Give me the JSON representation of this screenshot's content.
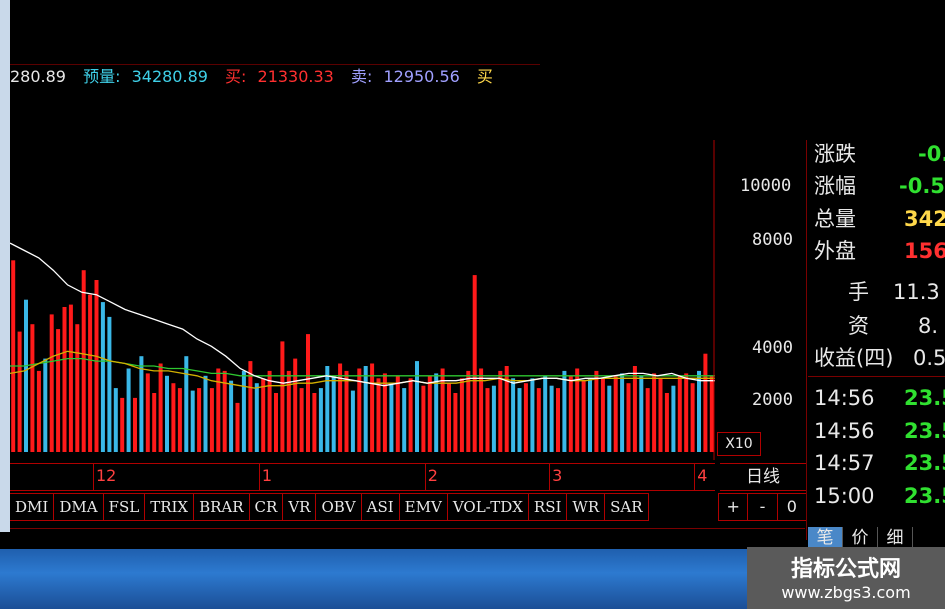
{
  "info_bar": {
    "items": [
      {
        "label": "",
        "value": "280.89",
        "color": "#e8e8e8"
      },
      {
        "label": "预量:",
        "value": "34280.89",
        "color": "#3fd0e8"
      },
      {
        "label": "买:",
        "value": "21330.33",
        "color": "#ff3030"
      },
      {
        "label": "卖:",
        "value": "12950.56",
        "color": "#a0a0ff"
      },
      {
        "label": "买",
        "value": "",
        "color": "#ffd84a"
      }
    ]
  },
  "volume_axis": {
    "labels": [
      "10000",
      "8000",
      "4000",
      "2000"
    ],
    "multiplier": "X10"
  },
  "chart_data": {
    "type": "bar",
    "ylabel": "",
    "ylim": [
      0,
      14000
    ],
    "yticks": [
      2000,
      4000,
      8000,
      10000
    ],
    "bar_up_color": "#ff1a1a",
    "bar_down_color": "#3ab8e8",
    "ma1_color": "#ffffff",
    "ma2_color": "#d2b000",
    "ma3_color": "#2ec830",
    "bars": [
      {
        "v": 7800,
        "up": true
      },
      {
        "v": 4900,
        "up": true
      },
      {
        "v": 6200,
        "up": false
      },
      {
        "v": 5200,
        "up": true
      },
      {
        "v": 3300,
        "up": true
      },
      {
        "v": 3800,
        "up": false
      },
      {
        "v": 5600,
        "up": true
      },
      {
        "v": 5000,
        "up": true
      },
      {
        "v": 5900,
        "up": true
      },
      {
        "v": 6000,
        "up": true
      },
      {
        "v": 5200,
        "up": true
      },
      {
        "v": 7400,
        "up": true
      },
      {
        "v": 6400,
        "up": true
      },
      {
        "v": 7000,
        "up": true
      },
      {
        "v": 6100,
        "up": false
      },
      {
        "v": 5500,
        "up": false
      },
      {
        "v": 2600,
        "up": false
      },
      {
        "v": 2200,
        "up": true
      },
      {
        "v": 3400,
        "up": false
      },
      {
        "v": 2200,
        "up": true
      },
      {
        "v": 3900,
        "up": false
      },
      {
        "v": 3200,
        "up": true
      },
      {
        "v": 2400,
        "up": true
      },
      {
        "v": 3600,
        "up": true
      },
      {
        "v": 3100,
        "up": false
      },
      {
        "v": 2800,
        "up": true
      },
      {
        "v": 2600,
        "up": true
      },
      {
        "v": 3900,
        "up": false
      },
      {
        "v": 2500,
        "up": false
      },
      {
        "v": 2600,
        "up": true
      },
      {
        "v": 3100,
        "up": false
      },
      {
        "v": 2600,
        "up": true
      },
      {
        "v": 3400,
        "up": true
      },
      {
        "v": 3300,
        "up": true
      },
      {
        "v": 2900,
        "up": false
      },
      {
        "v": 2000,
        "up": true
      },
      {
        "v": 3300,
        "up": false
      },
      {
        "v": 3700,
        "up": true
      },
      {
        "v": 2800,
        "up": false
      },
      {
        "v": 3000,
        "up": true
      },
      {
        "v": 3300,
        "up": true
      },
      {
        "v": 2400,
        "up": true
      },
      {
        "v": 4500,
        "up": true
      },
      {
        "v": 3300,
        "up": true
      },
      {
        "v": 3800,
        "up": true
      },
      {
        "v": 2600,
        "up": true
      },
      {
        "v": 4800,
        "up": true
      },
      {
        "v": 2400,
        "up": true
      },
      {
        "v": 2600,
        "up": false
      },
      {
        "v": 3500,
        "up": false
      },
      {
        "v": 3100,
        "up": false
      },
      {
        "v": 3600,
        "up": true
      },
      {
        "v": 3300,
        "up": true
      },
      {
        "v": 2500,
        "up": false
      },
      {
        "v": 3400,
        "up": true
      },
      {
        "v": 3500,
        "up": false
      },
      {
        "v": 3600,
        "up": true
      },
      {
        "v": 3000,
        "up": true
      },
      {
        "v": 3200,
        "up": true
      },
      {
        "v": 2800,
        "up": false
      },
      {
        "v": 3100,
        "up": true
      },
      {
        "v": 2600,
        "up": false
      },
      {
        "v": 3000,
        "up": true
      },
      {
        "v": 3700,
        "up": false
      },
      {
        "v": 2700,
        "up": true
      },
      {
        "v": 3100,
        "up": true
      },
      {
        "v": 3200,
        "up": false
      },
      {
        "v": 3400,
        "up": true
      },
      {
        "v": 2800,
        "up": true
      },
      {
        "v": 2400,
        "up": true
      },
      {
        "v": 3000,
        "up": true
      },
      {
        "v": 3300,
        "up": true
      },
      {
        "v": 7200,
        "up": true
      },
      {
        "v": 3400,
        "up": true
      },
      {
        "v": 2600,
        "up": true
      },
      {
        "v": 2700,
        "up": false
      },
      {
        "v": 3300,
        "up": true
      },
      {
        "v": 3500,
        "up": true
      },
      {
        "v": 3000,
        "up": false
      },
      {
        "v": 2600,
        "up": false
      },
      {
        "v": 2800,
        "up": true
      },
      {
        "v": 3000,
        "up": false
      },
      {
        "v": 2600,
        "up": true
      },
      {
        "v": 3100,
        "up": false
      },
      {
        "v": 2700,
        "up": false
      },
      {
        "v": 2600,
        "up": true
      },
      {
        "v": 3300,
        "up": false
      },
      {
        "v": 3100,
        "up": true
      },
      {
        "v": 3400,
        "up": true
      },
      {
        "v": 2900,
        "up": true
      },
      {
        "v": 3000,
        "up": false
      },
      {
        "v": 3300,
        "up": true
      },
      {
        "v": 3000,
        "up": true
      },
      {
        "v": 2700,
        "up": false
      },
      {
        "v": 3100,
        "up": true
      },
      {
        "v": 3200,
        "up": false
      },
      {
        "v": 2800,
        "up": true
      },
      {
        "v": 3500,
        "up": true
      },
      {
        "v": 3100,
        "up": false
      },
      {
        "v": 2600,
        "up": true
      },
      {
        "v": 3200,
        "up": true
      },
      {
        "v": 3000,
        "up": true
      },
      {
        "v": 2400,
        "up": true
      },
      {
        "v": 2700,
        "up": false
      },
      {
        "v": 3100,
        "up": true
      },
      {
        "v": 3200,
        "up": true
      },
      {
        "v": 2800,
        "up": true
      },
      {
        "v": 3300,
        "up": false
      },
      {
        "v": 4000,
        "up": true
      },
      {
        "v": 3100,
        "up": true
      }
    ],
    "ma1": [
      8500,
      8200,
      7900,
      7400,
      6800,
      6500,
      6400,
      6100,
      5800,
      5600,
      5400,
      5200,
      5000,
      4600,
      4300,
      3900,
      3400,
      3100,
      2900,
      2800,
      2900,
      3000,
      3100,
      3000,
      2900,
      2800,
      2700,
      2800,
      2900,
      2800,
      2900,
      2900,
      3000,
      3000,
      3000,
      2800,
      2900,
      3000,
      3000,
      2900,
      3000,
      3000,
      3100,
      3200,
      3200,
      3100,
      3200,
      3000,
      2900,
      2900
    ],
    "ma2": [
      3200,
      3300,
      3600,
      3900,
      4100,
      4000,
      3900,
      3700,
      3600,
      3400,
      3300,
      3300,
      3200,
      3100,
      2900,
      2800,
      2700,
      2600,
      2700,
      2700,
      2800,
      2800,
      2900,
      2900,
      2900,
      2800,
      2800,
      2800,
      2900,
      2800,
      2800,
      2800,
      2900,
      2900,
      3000,
      2900,
      2900,
      3000,
      3000,
      2900,
      2900,
      3000,
      3000,
      3000,
      3000,
      3000,
      3000,
      3000,
      3000,
      3000
    ],
    "ma3": [
      3500,
      3500,
      3600,
      3700,
      3800,
      3800,
      3700,
      3700,
      3600,
      3500,
      3500,
      3400,
      3400,
      3300,
      3200,
      3200,
      3100,
      3100,
      3100,
      3100,
      3100,
      3100,
      3100,
      3100,
      3100,
      3100,
      3100,
      3100,
      3100,
      3100,
      3100,
      3100,
      3100,
      3100,
      3100,
      3100,
      3100,
      3100,
      3100,
      3100,
      3100,
      3100,
      3100,
      3100,
      3100,
      3100,
      3100,
      3100,
      3100,
      3100
    ],
    "x_labels": [
      {
        "label": "12",
        "index": 8
      },
      {
        "label": "1",
        "index": 24
      },
      {
        "label": "2",
        "index": 40
      },
      {
        "label": "3",
        "index": 52
      },
      {
        "label": "4",
        "index": 66
      }
    ]
  },
  "period_label": "日线",
  "indicator_tabs": [
    "DMI",
    "DMA",
    "FSL",
    "TRIX",
    "BRAR",
    "CR",
    "VR",
    "OBV",
    "ASI",
    "EMV",
    "VOL-TDX",
    "RSI",
    "WR",
    "SAR"
  ],
  "zoom_buttons": [
    "+",
    "-",
    "0"
  ],
  "quote_panel": {
    "rows": [
      {
        "label": "涨跌",
        "value": "-0.",
        "color": "#30e030"
      },
      {
        "label": "涨幅",
        "value": "-0.5",
        "color": "#30e030"
      },
      {
        "label": "总量",
        "value": "342",
        "color": "#ffd84a"
      },
      {
        "label": "外盘",
        "value": "156",
        "color": "#ff3030"
      },
      {
        "label": "手",
        "value": "11.3",
        "color": "#e8e8e8"
      },
      {
        "label": "资",
        "value": "8.",
        "color": "#e8e8e8"
      },
      {
        "label": "收益(四)",
        "value": "0.5",
        "color": "#e8e8e8"
      }
    ],
    "ticks": [
      {
        "time": "14:56",
        "price": "23.5"
      },
      {
        "time": "14:56",
        "price": "23.5"
      },
      {
        "time": "14:57",
        "price": "23.5"
      },
      {
        "time": "15:00",
        "price": "23.5"
      }
    ],
    "tabs": [
      "笔",
      "价",
      "细"
    ]
  },
  "watermark": {
    "title": "指标公式网",
    "url": "www.zbgs3.com"
  }
}
